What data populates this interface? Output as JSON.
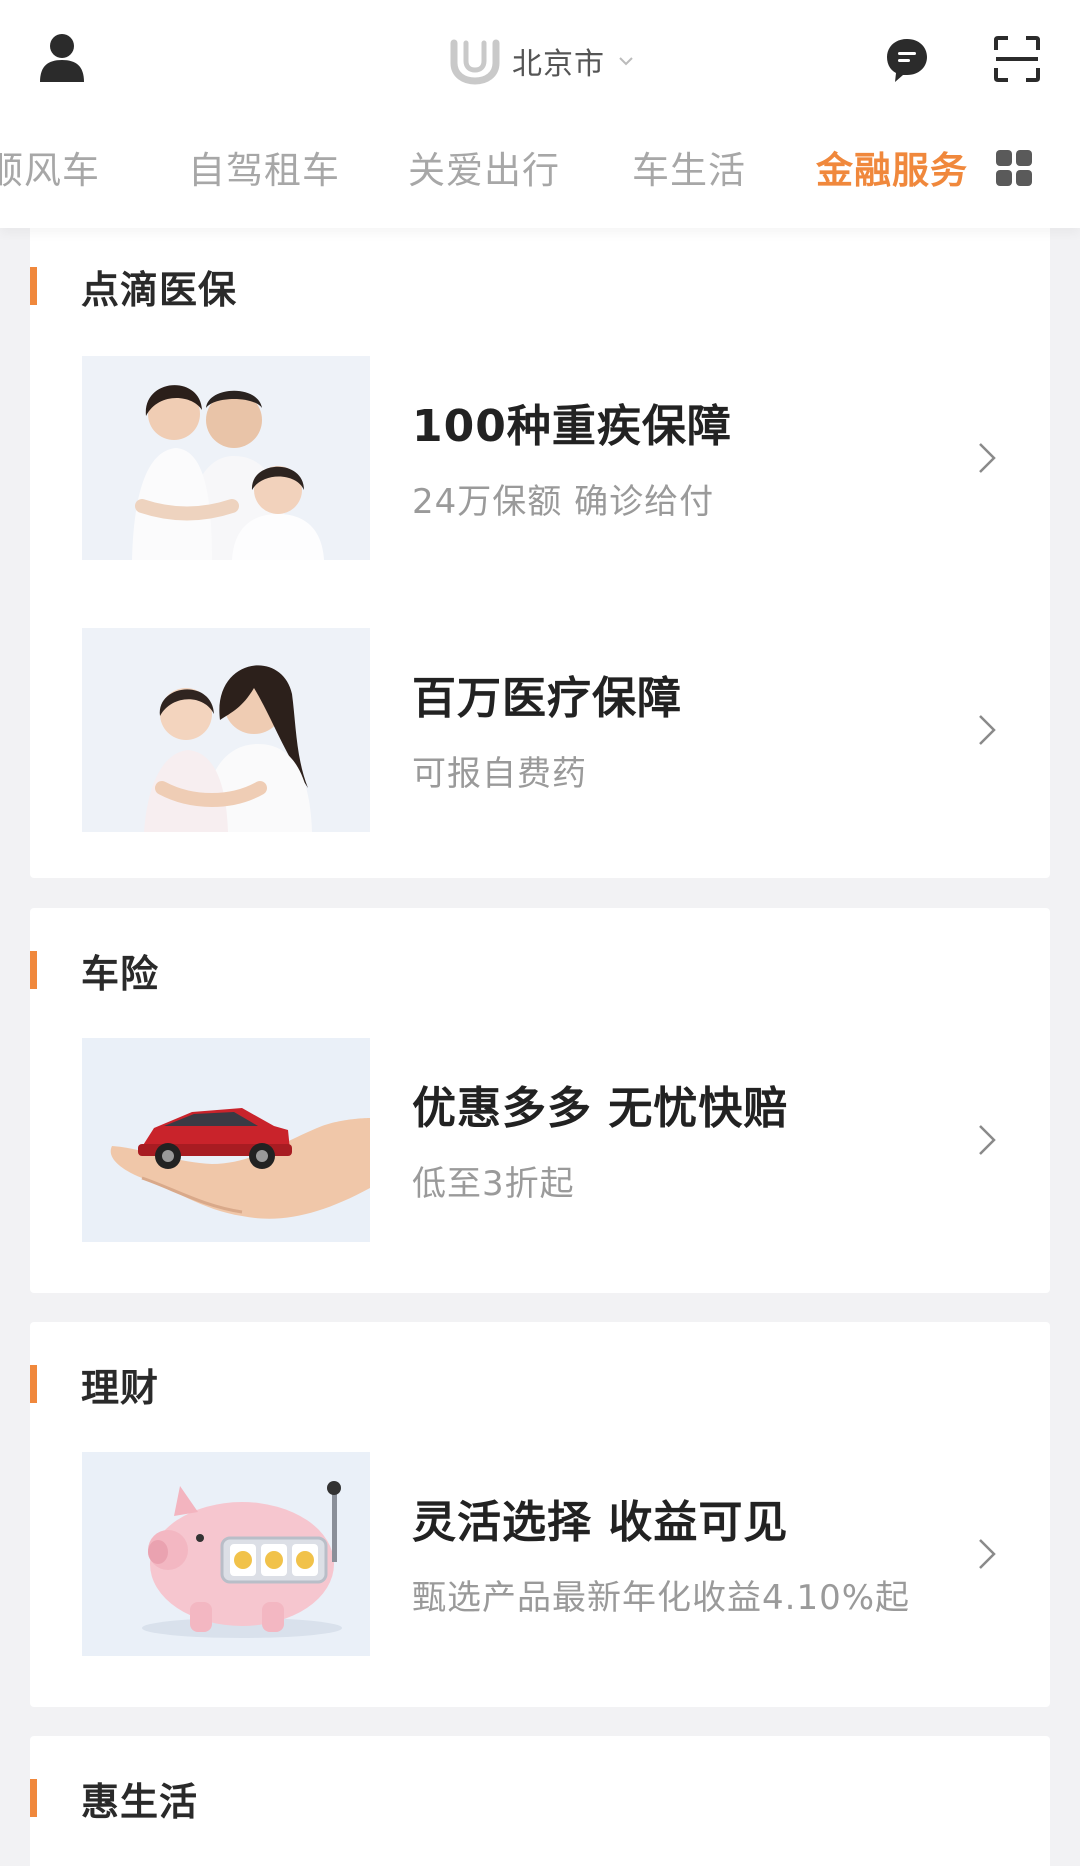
{
  "header": {
    "city": "北京市",
    "icons": {
      "profile": "person-icon",
      "brand": "didi-logo-icon",
      "message": "message-bubble-icon",
      "scan": "scan-icon"
    }
  },
  "tabs": [
    {
      "label": "顺风车"
    },
    {
      "label": "自驾租车"
    },
    {
      "label": "关爱出行"
    },
    {
      "label": "车生活"
    },
    {
      "label": "金融服务",
      "active": true
    }
  ],
  "sections": [
    {
      "title": "点滴医保",
      "items": [
        {
          "title": "100种重疾保障",
          "subtitle": "24万保额  确诊给付",
          "image": "family-of-three-photo"
        },
        {
          "title": "百万医疗保障",
          "subtitle": "可报自费药",
          "image": "mother-and-daughter-photo"
        }
      ]
    },
    {
      "title": "车险",
      "items": [
        {
          "title": "优惠多多  无忧快赔",
          "subtitle": "低至3折起",
          "image": "car-on-hand-photo"
        }
      ]
    },
    {
      "title": "理财",
      "items": [
        {
          "title": "灵活选择  收益可见",
          "subtitle": "甄选产品最新年化收益4.10%起",
          "image": "piggy-bank-slot-machine"
        }
      ]
    },
    {
      "title": "惠生活",
      "items": []
    }
  ],
  "colors": {
    "accent": "#f0883c",
    "background": "#f2f2f4",
    "card": "#ffffff"
  }
}
